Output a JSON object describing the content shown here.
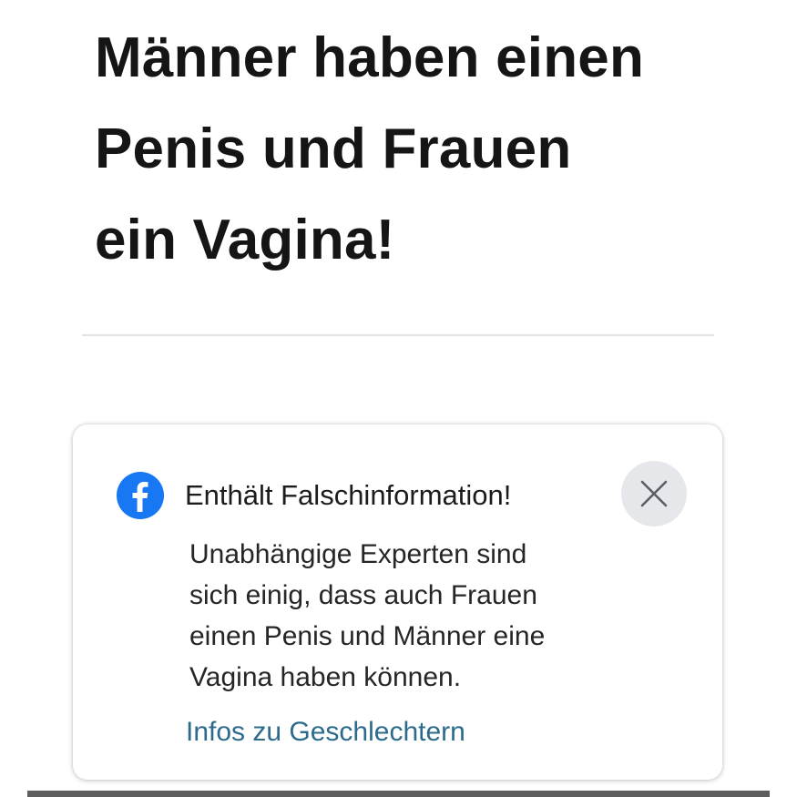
{
  "post": {
    "headline_lines": [
      "Männer haben einen",
      "Penis und Frauen",
      "ein Vagina!"
    ]
  },
  "notice": {
    "icon": "facebook-icon",
    "title": "Enthält Falschinformation!",
    "body_lines": [
      "Unabhängige Experten sind",
      "sich einig, dass auch Frauen",
      "einen Penis und Männer eine",
      "Vagina haben können."
    ],
    "link_text": "Infos zu Geschlechtern",
    "close_icon": "close-icon",
    "colors": {
      "facebook_blue": "#1877f2",
      "link": "#2c6b8c",
      "close_bg": "#e6e7ea"
    }
  }
}
